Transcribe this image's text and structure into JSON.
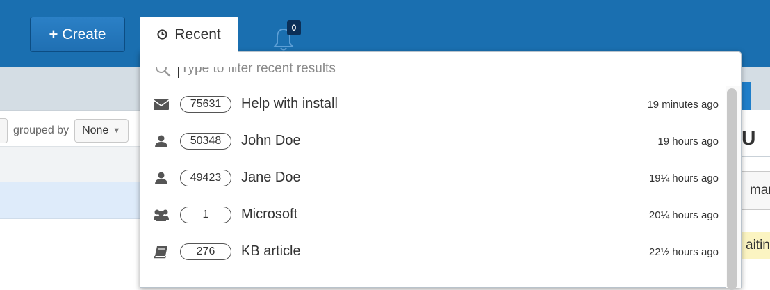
{
  "header": {
    "create_label": "Create",
    "recent_label": "Recent",
    "notifications_count": "0"
  },
  "filter": {
    "placeholder": "Type to filter recent results",
    "value": ""
  },
  "recent_items": [
    {
      "icon": "envelope-icon",
      "id": "75631",
      "title": "Help with install",
      "time": "19 minutes ago"
    },
    {
      "icon": "person-icon",
      "id": "50348",
      "title": "John Doe",
      "time": "19 hours ago"
    },
    {
      "icon": "person-icon",
      "id": "49423",
      "title": "Jane Doe",
      "time": "19¼ hours ago"
    },
    {
      "icon": "group-icon",
      "id": "1",
      "title": "Microsoft",
      "time": "20¼ hours ago"
    },
    {
      "icon": "book-icon",
      "id": "276",
      "title": "KB article",
      "time": "22½ hours ago"
    }
  ],
  "background": {
    "grouped_by_label": "grouped by",
    "grouped_by_value": "None",
    "right_title": ": U",
    "right_field": "man",
    "right_status": "aiting"
  },
  "colors": {
    "topbar": "#1a6fb0",
    "badge": "#0b2f57",
    "strip": "#d4dde4",
    "selected_row": "#deebfa",
    "waiting": "#fbf4c2"
  }
}
